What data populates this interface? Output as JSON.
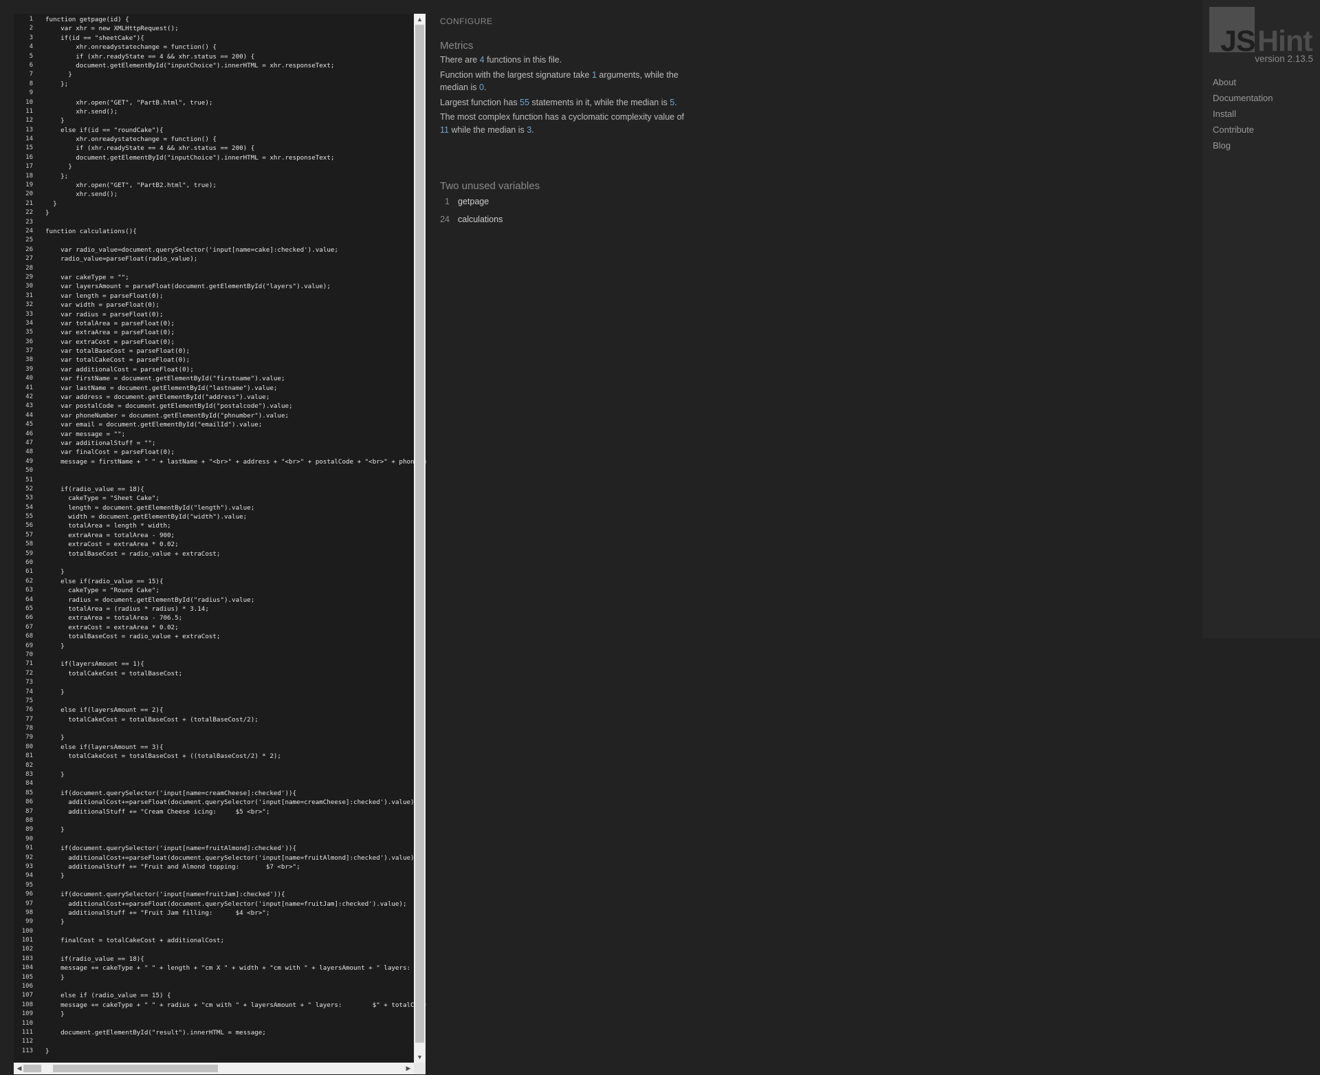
{
  "editor": {
    "lines": [
      "function getpage(id) {",
      "    var xhr = new XMLHttpRequest();",
      "    if(id == \"sheetCake\"){",
      "        xhr.onreadystatechange = function() {",
      "        if (xhr.readyState == 4 && xhr.status == 200) {",
      "        document.getElementById(\"inputChoice\").innerHTML = xhr.responseText;",
      "      }",
      "    };",
      "",
      "        xhr.open(\"GET\", \"PartB.html\", true);",
      "        xhr.send();",
      "    }",
      "    else if(id == \"roundCake\"){",
      "        xhr.onreadystatechange = function() {",
      "        if (xhr.readyState == 4 && xhr.status == 200) {",
      "        document.getElementById(\"inputChoice\").innerHTML = xhr.responseText;",
      "      }",
      "    };",
      "        xhr.open(\"GET\", \"PartB2.html\", true);",
      "        xhr.send();",
      "  }",
      "}",
      "",
      "function calculations(){",
      "",
      "    var radio_value=document.querySelector('input[name=cake]:checked').value;",
      "    radio_value=parseFloat(radio_value);",
      "",
      "    var cakeType = \"\";",
      "    var layersAmount = parseFloat(document.getElementById(\"layers\").value);",
      "    var length = parseFloat(0);",
      "    var width = parseFloat(0);",
      "    var radius = parseFloat(0);",
      "    var totalArea = parseFloat(0);",
      "    var extraArea = parseFloat(0);",
      "    var extraCost = parseFloat(0);",
      "    var totalBaseCost = parseFloat(0);",
      "    var totalCakeCost = parseFloat(0);",
      "    var additionalCost = parseFloat(0);",
      "    var firstName = document.getElementById(\"firstname\").value;",
      "    var lastName = document.getElementById(\"lastname\").value;",
      "    var address = document.getElementById(\"address\").value;",
      "    var postalCode = document.getElementById(\"postalcode\").value;",
      "    var phoneNumber = document.getElementById(\"phnumber\").value;",
      "    var email = document.getElementById(\"emailId\").value;",
      "    var message = \"\";",
      "    var additionalStuff = \"\";",
      "    var finalCost = parseFloat(0);",
      "    message = firstName + \" \" + lastName + \"<br>\" + address + \"<br>\" + postalCode + \"<br>\" + phoneNumber + \"<br>\" + email + \"<br>\";",
      "",
      "",
      "    if(radio_value == 18){",
      "      cakeType = \"Sheet Cake\";",
      "      length = document.getElementById(\"length\").value;",
      "      width = document.getElementById(\"width\").value;",
      "      totalArea = length * width;",
      "      extraArea = totalArea - 900;",
      "      extraCost = extraArea * 0.02;",
      "      totalBaseCost = radio_value + extraCost;",
      "",
      "    }",
      "    else if(radio_value == 15){",
      "      cakeType = \"Round Cake\";",
      "      radius = document.getElementById(\"radius\").value;",
      "      totalArea = (radius * radius) * 3.14;",
      "      extraArea = totalArea - 706.5;",
      "      extraCost = extraArea * 0.02;",
      "      totalBaseCost = radio_value + extraCost;",
      "    }",
      "",
      "    if(layersAmount == 1){",
      "      totalCakeCost = totalBaseCost;",
      "",
      "    }",
      "",
      "    else if(layersAmount == 2){",
      "      totalCakeCost = totalBaseCost + (totalBaseCost/2);",
      "",
      "    }",
      "    else if(layersAmount == 3){",
      "      totalCakeCost = totalBaseCost + ((totalBaseCost/2) * 2);",
      "",
      "    }",
      "",
      "    if(document.querySelector('input[name=creamCheese]:checked')){",
      "      additionalCost+=parseFloat(document.querySelector('input[name=creamCheese]:checked').value);",
      "      additionalStuff += \"Cream Cheese icing:     $5 <br>\";",
      "",
      "    }",
      "",
      "    if(document.querySelector('input[name=fruitAlmond]:checked')){",
      "      additionalCost+=parseFloat(document.querySelector('input[name=fruitAlmond]:checked').value);",
      "      additionalStuff += \"Fruit and Almond topping:       $7 <br>\";",
      "    }",
      "",
      "    if(document.querySelector('input[name=fruitJam]:checked')){",
      "      additionalCost+=parseFloat(document.querySelector('input[name=fruitJam]:checked').value);",
      "      additionalStuff += \"Fruit Jam filling:      $4 <br>\";",
      "    }",
      "",
      "    finalCost = totalCakeCost + additionalCost;",
      "",
      "    if(radio_value == 18){",
      "    message += cakeType + \" \" + length + \"cm X \" + width + \"cm with \" + layersAmount + \" layers:",
      "    }",
      "",
      "    else if (radio_value == 15) {",
      "    message += cakeType + \" \" + radius + \"cm with \" + layersAmount + \" layers:        $\" + totalCakeCost",
      "    }",
      "",
      "    document.getElementById(\"result\").innerHTML = message;",
      "",
      "}"
    ]
  },
  "report": {
    "configure": "CONFIGURE",
    "metrics_title": "Metrics",
    "m1a": "There are ",
    "m1n": "4",
    "m1b": " functions in this file.",
    "m2a": "Function with the largest signature take ",
    "m2n": "1",
    "m2b": " arguments, while the median is ",
    "m2m": "0",
    "m2c": ".",
    "m3a": "Largest function has ",
    "m3n": "55",
    "m3b": " statements in it, while the median is ",
    "m3m": "5",
    "m3c": ".",
    "m4a": "The most complex function has a cyclomatic complexity value of ",
    "m4n": "11",
    "m4b": " while the median is ",
    "m4m": "3",
    "m4c": ".",
    "unused_title": "Two unused variables",
    "unused": [
      {
        "line": "1",
        "name": "getpage"
      },
      {
        "line": "24",
        "name": "calculations"
      }
    ]
  },
  "sidebar": {
    "logo_js": "JS",
    "logo_hint": "Hint",
    "version": "version 2.13.5",
    "nav": [
      "About",
      "Documentation",
      "Install",
      "Contribute",
      "Blog"
    ]
  },
  "colors": {
    "background": "#222222",
    "editor_bg": "#1c1c1c",
    "highlight": "#6fa8d8"
  }
}
